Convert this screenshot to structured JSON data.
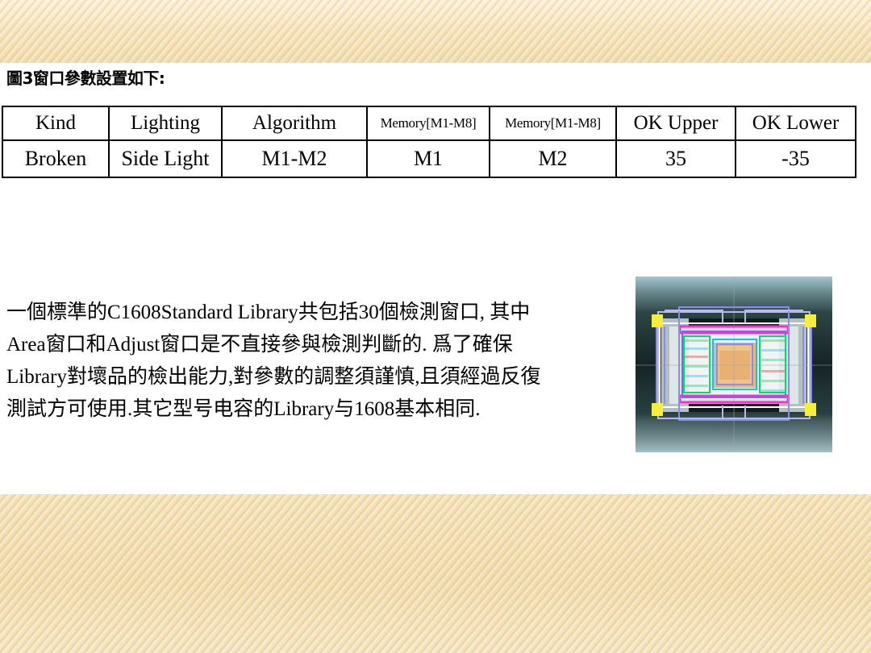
{
  "slide": {
    "caption": "圖3窗口參數設置如下:",
    "background_color": "#ffffff",
    "band_color": "#f2debb"
  },
  "param_table": {
    "headers": [
      "Kind",
      "Lighting",
      "Algorithm",
      "Memory[M1-M8]",
      "Memory[M1-M8]",
      "OK Upper",
      "OK Lower"
    ],
    "rows": [
      {
        "kind": "Broken",
        "lighting": "Side Light",
        "algorithm": "M1-M2",
        "memory_a": "M1",
        "memory_b": "M2",
        "ok_upper": "35",
        "ok_lower": "-35"
      }
    ]
  },
  "paragraph": {
    "line1": "一個標準的C1608Standard Library共包括30個檢測窗口, 其中",
    "line2": "Area窗口和Adjust窗口是不直接參與檢測判斷的. 爲了確保",
    "line3": "Library對壞品的檢出能力,對參數的調整須謹慎,且須經過反復",
    "line4": "測試方可使用.其它型号电容的Library与1608基本相同."
  },
  "inspection_image": {
    "label": "component-inspection-windows",
    "corner_marker_color": "#f5ee3a",
    "window_colors": [
      "#8c8cf0",
      "#ff2ad2",
      "#00c8ff",
      "#00e060",
      "#b9b9ee",
      "#ffffff"
    ],
    "body_color": "#e8b87a",
    "background_color": "#1e3030"
  }
}
